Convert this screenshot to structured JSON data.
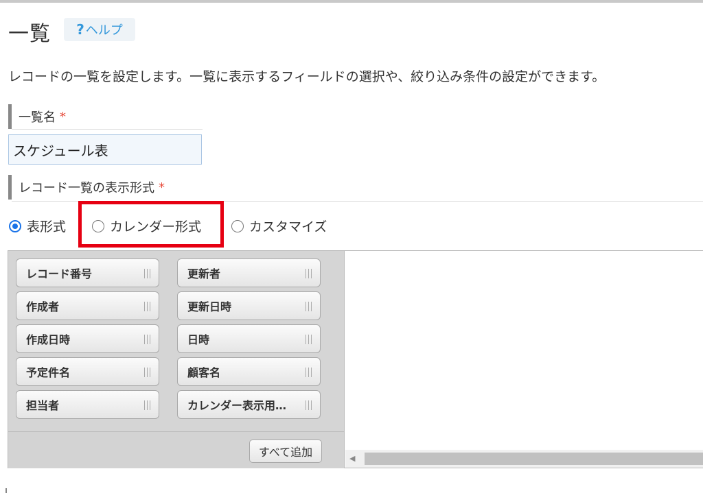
{
  "header": {
    "title": "一覧",
    "help_icon": "question-icon",
    "help_label": "ヘルプ"
  },
  "description": "レコードの一覧を設定します。一覧に表示するフィールドの選択や、絞り込み条件の設定ができます。",
  "list_name": {
    "label": "一覧名",
    "required_mark": "*",
    "value": "スケジュール表"
  },
  "display_format": {
    "label": "レコード一覧の表示形式",
    "required_mark": "*",
    "options": [
      {
        "label": "表形式",
        "selected": true
      },
      {
        "label": "カレンダー形式",
        "selected": false
      },
      {
        "label": "カスタマイズ",
        "selected": false
      }
    ]
  },
  "fields": {
    "left_column": [
      "レコード番号",
      "作成者",
      "作成日時",
      "予定件名",
      "担当者"
    ],
    "right_column": [
      "更新者",
      "更新日時",
      "日時",
      "顧客名",
      "カレンダー表示用…"
    ],
    "add_all_label": "すべて追加"
  },
  "colors": {
    "accent": "#1a73e8",
    "help_text": "#3498db",
    "required": "#e74c3c",
    "highlight": "#e60012"
  }
}
